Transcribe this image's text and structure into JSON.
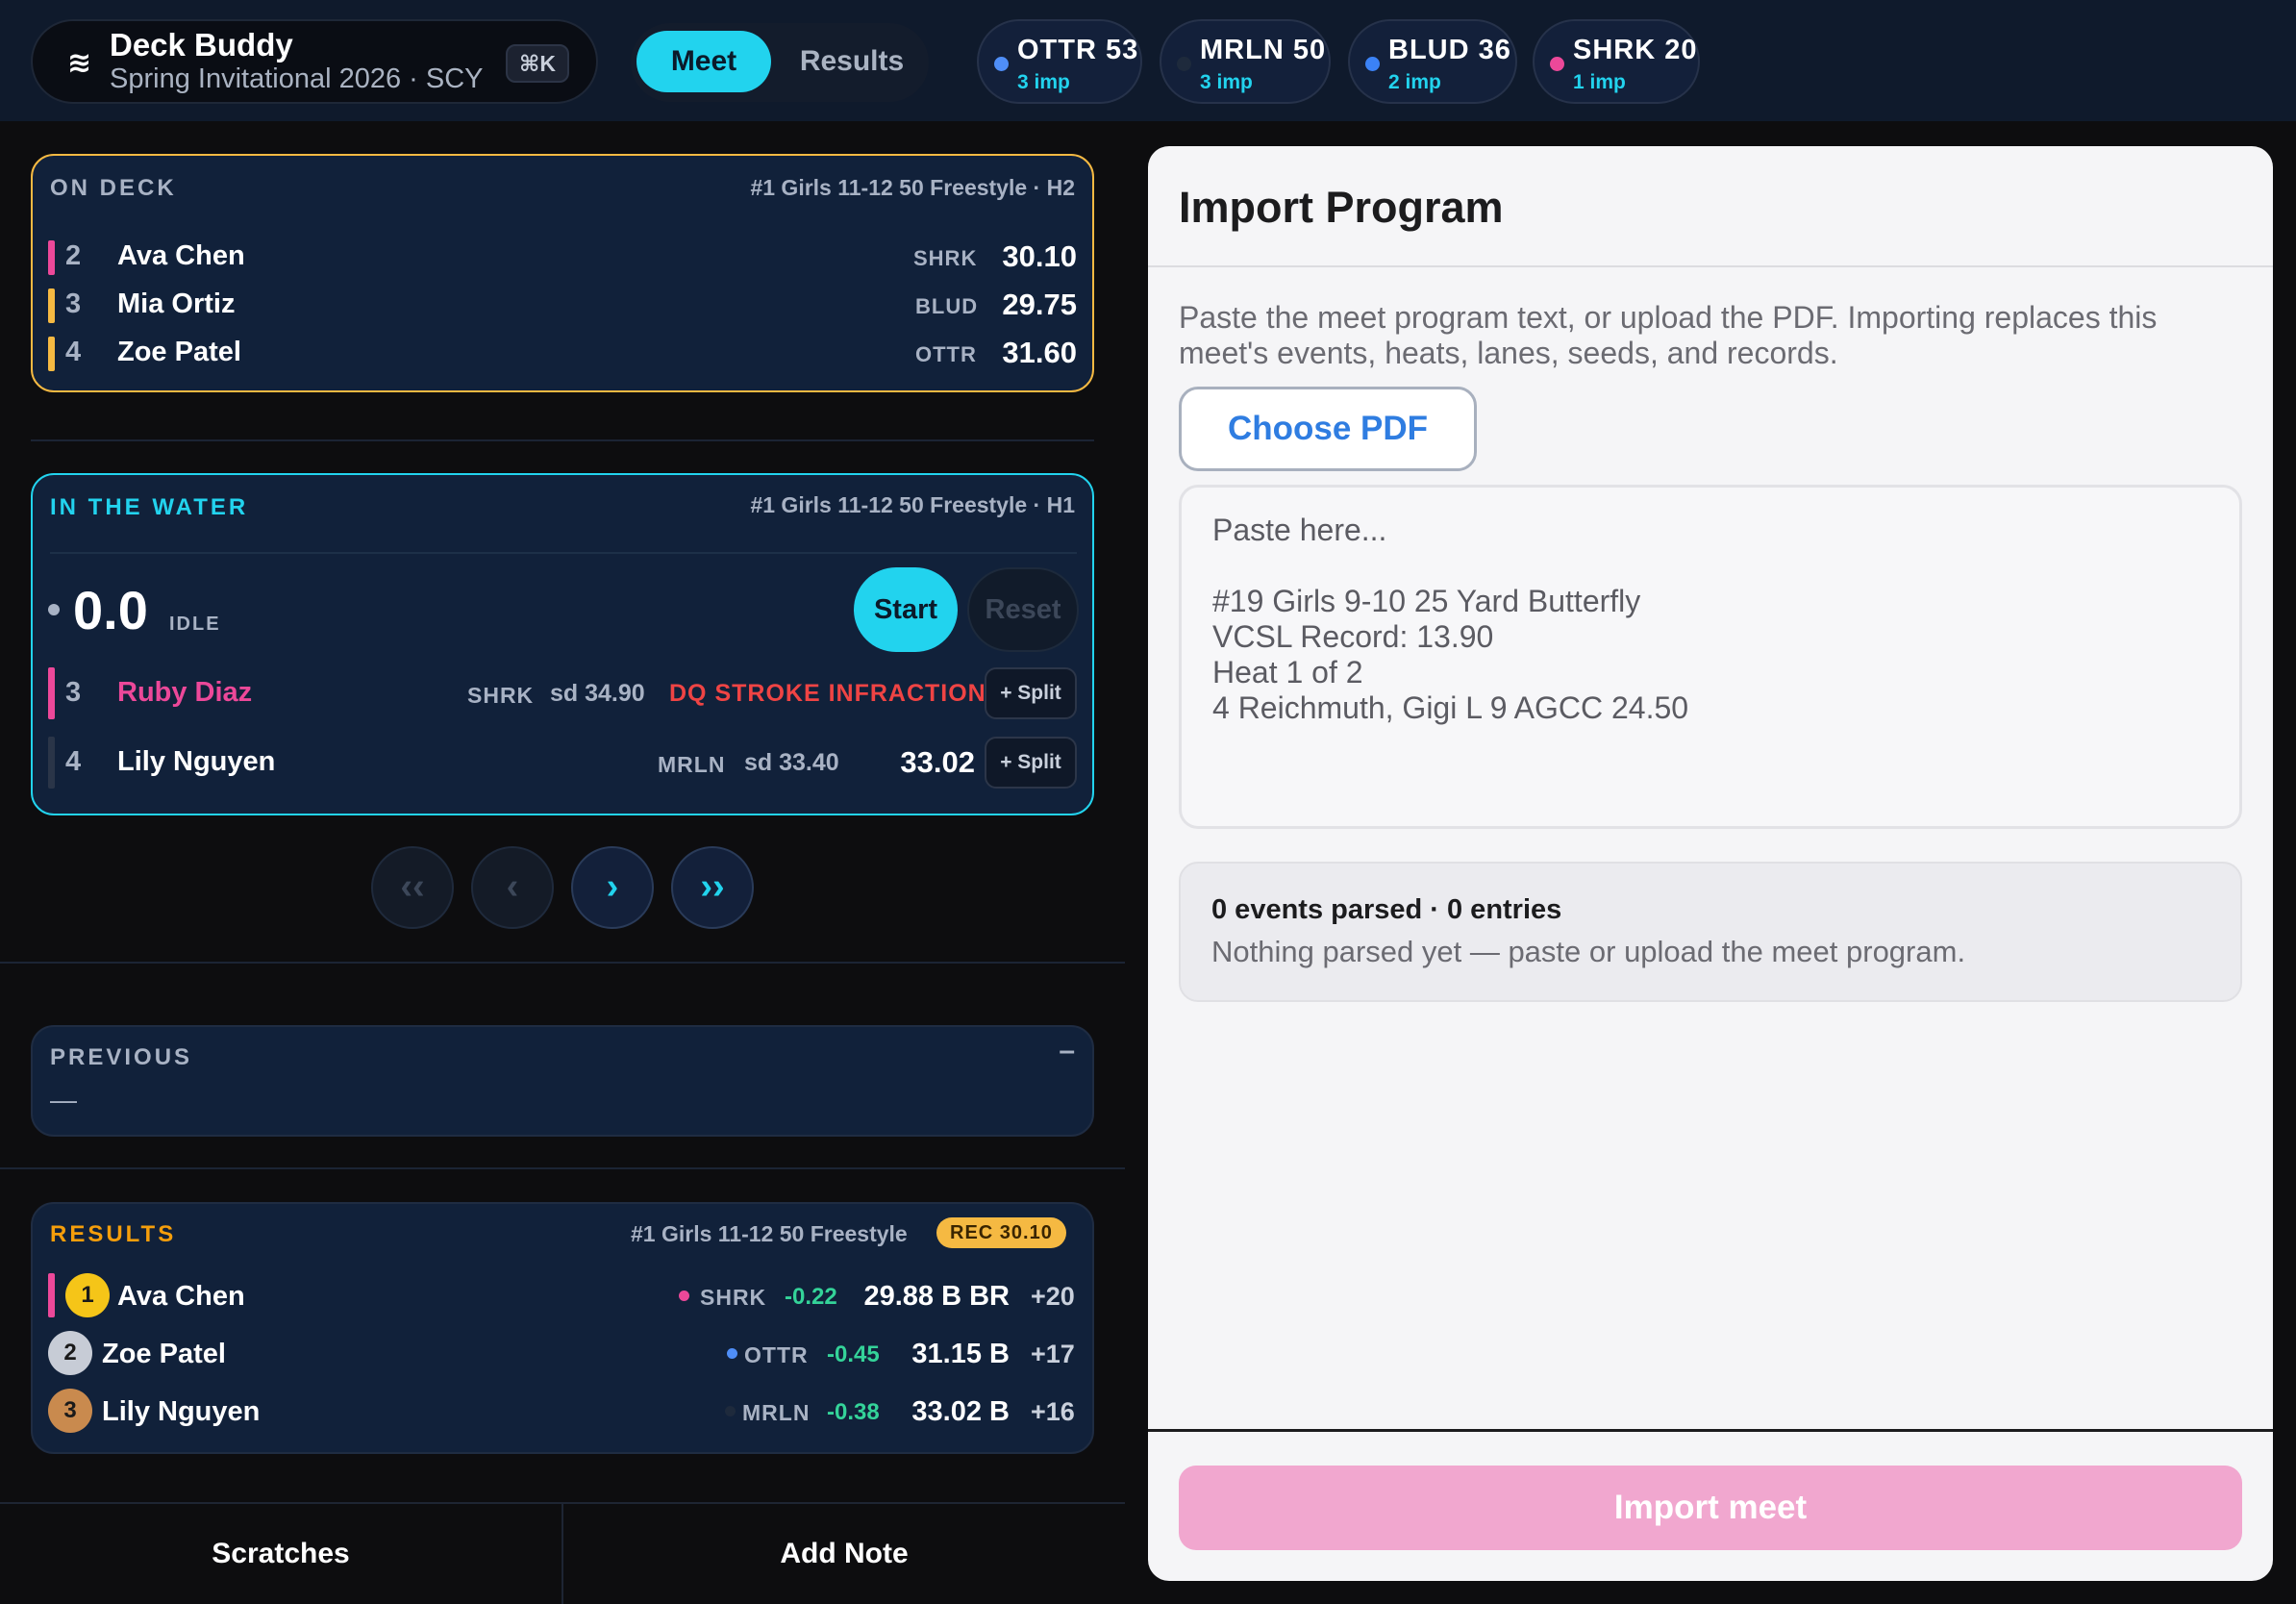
{
  "brand": {
    "icon": "waves-icon",
    "name": "Deck Buddy",
    "meet": "Spring Invitational 2026 · SCY",
    "shortcut": "⌘K"
  },
  "tabs": {
    "meet": "Meet",
    "results": "Results",
    "active": "Meet"
  },
  "teams": [
    {
      "code": "OTTR",
      "score": "53",
      "imp": "3 imp",
      "color": "#4f8ef7"
    },
    {
      "code": "MRLN",
      "score": "50",
      "imp": "3 imp",
      "color": "#1e2a3c"
    },
    {
      "code": "BLUD",
      "score": "36",
      "imp": "2 imp",
      "color": "#3b82f6"
    },
    {
      "code": "SHRK",
      "score": "20",
      "imp": "1 imp",
      "color": "#ec4899"
    }
  ],
  "on_deck": {
    "label": "ON DECK",
    "event": "#1 Girls 11-12 50 Freestyle · H2",
    "lanes": [
      {
        "lane": "2",
        "name": "Ava Chen",
        "team": "SHRK",
        "seed": "30.10",
        "color": "#ec4899"
      },
      {
        "lane": "3",
        "name": "Mia Ortiz",
        "team": "BLUD",
        "seed": "29.75",
        "color": "#f5b942"
      },
      {
        "lane": "4",
        "name": "Zoe Patel",
        "team": "OTTR",
        "seed": "31.60",
        "color": "#f5b942"
      }
    ]
  },
  "in_water": {
    "label": "IN THE WATER",
    "event": "#1 Girls 11-12 50 Freestyle · H1",
    "clock": "0.0",
    "state": "IDLE",
    "start": "Start",
    "reset": "Reset",
    "lanes": [
      {
        "lane": "3",
        "name": "Ruby Diaz",
        "team": "SHRK",
        "seed": "sd 34.90",
        "status": "DQ STROKE INFRACTION",
        "time": "",
        "split": "+ Split",
        "color": "#ec4899"
      },
      {
        "lane": "4",
        "name": "Lily Nguyen",
        "team": "MRLN",
        "seed": "sd 33.40",
        "status": "",
        "time": "33.02",
        "split": "+ Split",
        "color": "#2a3548"
      }
    ]
  },
  "nav": {
    "first": "‹‹",
    "prev": "‹",
    "next": "›",
    "last": "››"
  },
  "previous": {
    "label": "PREVIOUS",
    "collapse": "–",
    "value": "—"
  },
  "results": {
    "label": "RESULTS",
    "event": "#1 Girls 11-12 50 Freestyle",
    "record": "REC 30.10",
    "rows": [
      {
        "place": "1",
        "name": "Ava Chen",
        "team": "SHRK",
        "delta": "-0.22",
        "time": "29.88 B BR",
        "points": "+20",
        "team_color": "#ec4899",
        "medal": "#f5c518"
      },
      {
        "place": "2",
        "name": "Zoe Patel",
        "team": "OTTR",
        "delta": "-0.45",
        "time": "31.15 B",
        "points": "+17",
        "team_color": "#4f8ef7",
        "medal": "#c7ccd6"
      },
      {
        "place": "3",
        "name": "Lily Nguyen",
        "team": "MRLN",
        "delta": "-0.38",
        "time": "33.02 B",
        "points": "+16",
        "team_color": "#1e2a3c",
        "medal": "#c98a4e"
      }
    ]
  },
  "bottom": {
    "scratches": "Scratches",
    "add_note": "Add Note"
  },
  "import": {
    "title": "Import Program",
    "description": "Paste the meet program text, or upload the PDF. Importing replaces this meet's events, heats, lanes, seeds, and records.",
    "choose_pdf": "Choose PDF",
    "placeholder": "Paste here...\n\n#19 Girls 9-10 25 Yard Butterfly\nVCSL Record: 13.90\nHeat 1 of 2\n4 Reichmuth, Gigi L 9 AGCC 24.50",
    "parsed_summary": "0 events parsed · 0 entries",
    "parsed_detail": "Nothing parsed yet — paste or upload the meet program.",
    "import_button": "Import meet"
  }
}
